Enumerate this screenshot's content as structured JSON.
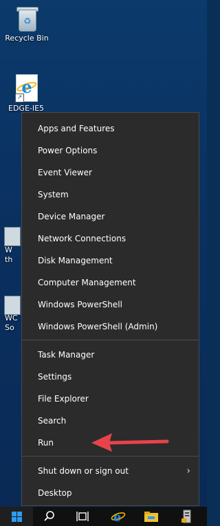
{
  "desktop": {
    "recycle_bin_label": "Recycle Bin",
    "ie_label_partial": "EDGE-IE5",
    "partial_icon_1": "W",
    "partial_icon_1b": "th",
    "partial_icon_2": "WC",
    "partial_icon_2b": "So"
  },
  "menu": {
    "group1": [
      "Apps and Features",
      "Power Options",
      "Event Viewer",
      "System",
      "Device Manager",
      "Network Connections",
      "Disk Management",
      "Computer Management",
      "Windows PowerShell",
      "Windows PowerShell (Admin)"
    ],
    "group2": [
      "Task Manager",
      "Settings",
      "File Explorer",
      "Search",
      "Run"
    ],
    "shutdown_label": "Shut down or sign out",
    "desktop_label": "Desktop"
  },
  "taskbar": {
    "icons": [
      "windows-start-icon",
      "search-icon",
      "task-view-icon",
      "internet-explorer-icon",
      "file-explorer-icon",
      "server-manager-icon"
    ]
  },
  "colors": {
    "menu_bg": "#2b2b2b",
    "accent": "#2e9bf0",
    "annotation_arrow": "#e8434a"
  }
}
